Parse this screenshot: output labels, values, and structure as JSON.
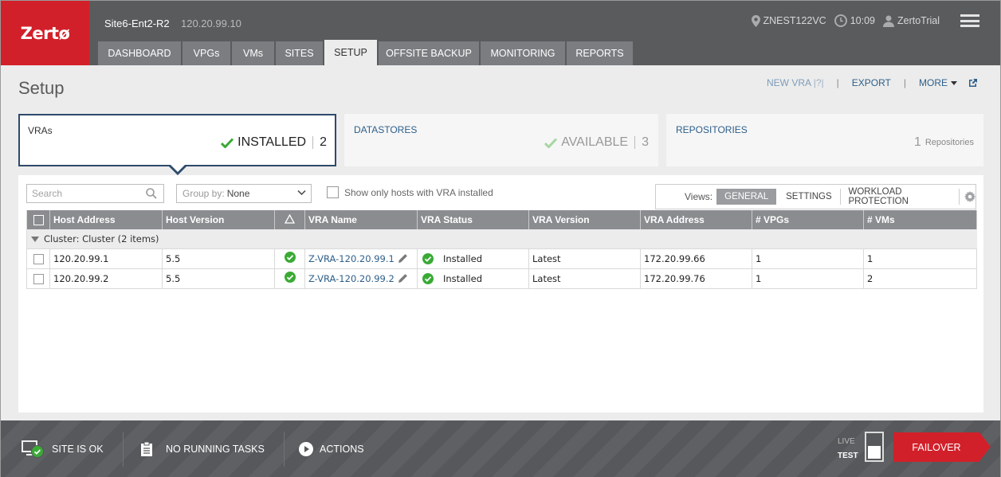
{
  "app": {
    "logo_text": "Zertø",
    "brand_color": "#d2202a",
    "site_name": "Site6-Ent2-R2",
    "site_ip": "120.20.99.10",
    "vcenter": "ZNEST122VC",
    "time": "10:09",
    "user": "ZertoTrial"
  },
  "nav": {
    "tabs": [
      {
        "label": "DASHBOARD",
        "active": false
      },
      {
        "label": "VPGs",
        "active": false
      },
      {
        "label": "VMs",
        "active": false
      },
      {
        "label": "SITES",
        "active": false
      },
      {
        "label": "SETUP",
        "active": true
      },
      {
        "label": "OFFSITE BACKUP",
        "active": false
      },
      {
        "label": "MONITORING",
        "active": false
      },
      {
        "label": "REPORTS",
        "active": false
      }
    ]
  },
  "page": {
    "title": "Setup",
    "actions": {
      "new_vra": "NEW VRA",
      "new_vra_help": "|?|",
      "sep": "|",
      "export": "EXPORT",
      "more": "MORE"
    }
  },
  "cards": {
    "vras": {
      "label": "VRAs",
      "status": "INSTALLED",
      "count": "2"
    },
    "datastores": {
      "label": "DATASTORES",
      "status": "AVAILABLE",
      "count": "3"
    },
    "repositories": {
      "label": "REPOSITORIES",
      "count": "1",
      "unit": "Repositories"
    }
  },
  "toolbar": {
    "search_placeholder": "Search",
    "group_by_label": "Group by:",
    "group_by_value": "None",
    "show_only_label": "Show only hosts with VRA installed",
    "views_label": "Views:",
    "views": [
      "GENERAL",
      "SETTINGS",
      "WORKLOAD PROTECTION"
    ],
    "active_view": "GENERAL"
  },
  "table": {
    "columns": [
      "",
      "Host Address",
      "Host Version",
      "△",
      "VRA Name",
      "VRA Status",
      "VRA Version",
      "VRA Address",
      "# VPGs",
      "# VMs"
    ],
    "group_label": "Cluster: Cluster (2 items)",
    "rows": [
      {
        "host": "120.20.99.1",
        "version": "5.5",
        "vra_name": "Z-VRA-120.20.99.1",
        "vra_status": "Installed",
        "vra_version": "Latest",
        "vra_address": "172.20.99.66",
        "vpgs": "1",
        "vms": "1"
      },
      {
        "host": "120.20.99.2",
        "version": "5.5",
        "vra_name": "Z-VRA-120.20.99.2",
        "vra_status": "Installed",
        "vra_version": "Latest",
        "vra_address": "172.20.99.76",
        "vpgs": "1",
        "vms": "2"
      }
    ]
  },
  "footer": {
    "site_status": "SITE IS OK",
    "tasks": "NO RUNNING TASKS",
    "actions": "ACTIONS",
    "live": "LIVE",
    "test": "TEST",
    "failover": "FAILOVER"
  }
}
